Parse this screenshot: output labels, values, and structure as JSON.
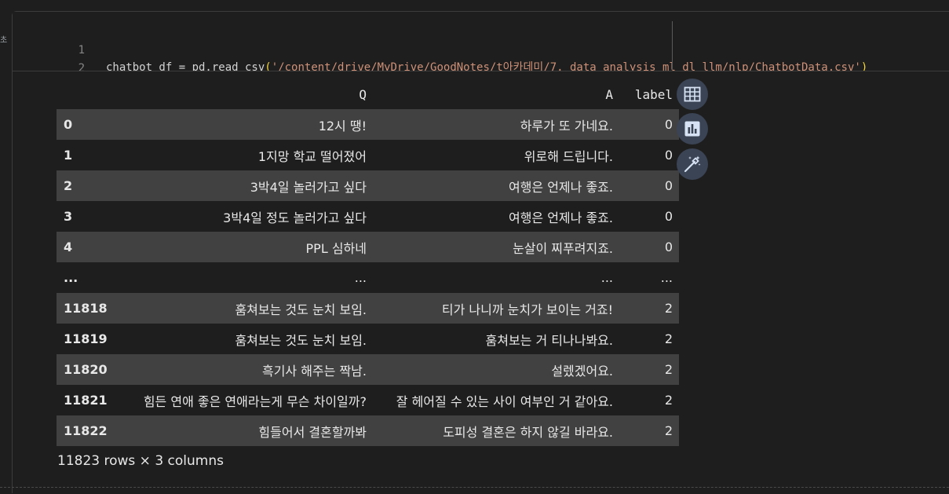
{
  "gutter": {
    "mark": "초"
  },
  "code": {
    "lines": [
      {
        "number": "1",
        "prefix": "chatbot_df = pd.read_csv",
        "open": "(",
        "quote_open": "'",
        "path_link": "/content/drive/MyDrive/GoodNotes",
        "path_rest": "/t아카데미/7. data_analysis_ml_dl_llm/nlp/ChatbotData.csv",
        "quote_close": "'",
        "close": ")"
      },
      {
        "number": "2",
        "text": "chatbot_df"
      }
    ]
  },
  "dataframe": {
    "columns": [
      "",
      "Q",
      "A",
      "label"
    ],
    "rows": [
      {
        "index": "0",
        "q": "12시 땡!",
        "a": "하루가 또 가네요.",
        "label": "0"
      },
      {
        "index": "1",
        "q": "1지망 학교 떨어졌어",
        "a": "위로해 드립니다.",
        "label": "0"
      },
      {
        "index": "2",
        "q": "3박4일 놀러가고 싶다",
        "a": "여행은 언제나 좋죠.",
        "label": "0"
      },
      {
        "index": "3",
        "q": "3박4일 정도 놀러가고 싶다",
        "a": "여행은 언제나 좋죠.",
        "label": "0"
      },
      {
        "index": "4",
        "q": "PPL 심하네",
        "a": "눈살이 찌푸려지죠.",
        "label": "0"
      },
      {
        "index": "...",
        "q": "...",
        "a": "...",
        "label": "..."
      },
      {
        "index": "11818",
        "q": "훔쳐보는 것도 눈치 보임.",
        "a": "티가 나니까 눈치가 보이는 거죠!",
        "label": "2"
      },
      {
        "index": "11819",
        "q": "훔쳐보는 것도 눈치 보임.",
        "a": "훔쳐보는 거 티나나봐요.",
        "label": "2"
      },
      {
        "index": "11820",
        "q": "흑기사 해주는 짝남.",
        "a": "설렜겠어요.",
        "label": "2"
      },
      {
        "index": "11821",
        "q": "힘든 연애 좋은 연애라는게 무슨 차이일까?",
        "a": "잘 헤어질 수 있는 사이 여부인 거 같아요.",
        "label": "2"
      },
      {
        "index": "11822",
        "q": "힘들어서 결혼할까봐",
        "a": "도피성 결혼은 하지 않길 바라요.",
        "label": "2"
      }
    ],
    "shape": "11823 rows × 3 columns"
  },
  "toolbar": {
    "buttons": [
      {
        "name": "table-icon"
      },
      {
        "name": "chart-icon"
      },
      {
        "name": "magic-wand-icon"
      }
    ]
  },
  "colors": {
    "background": "#1e1e1e",
    "stripe": "#414141",
    "button": "#3b4455",
    "paren": "#f2d33e",
    "string": "#ce9178"
  }
}
